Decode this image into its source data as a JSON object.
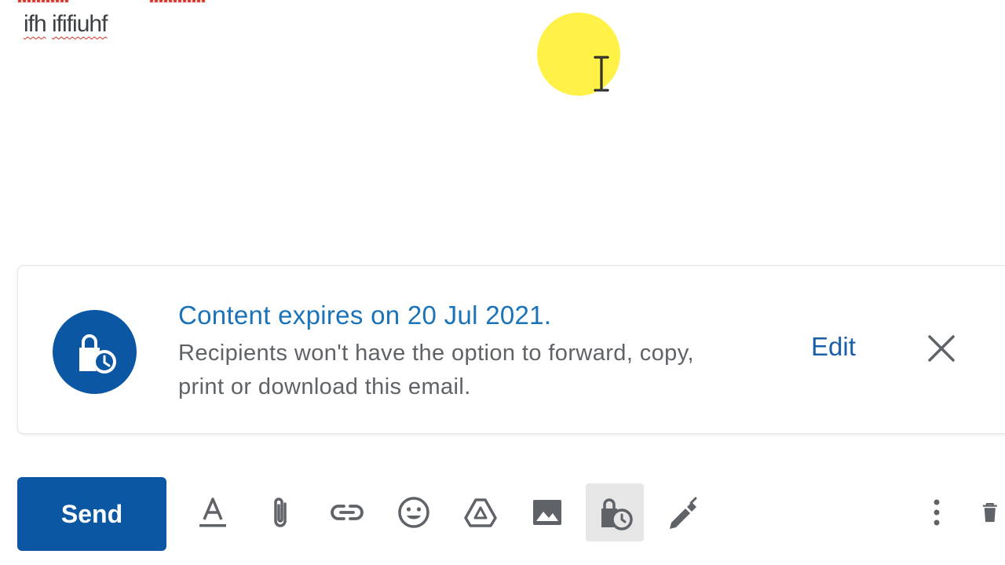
{
  "compose": {
    "body_text_1": "ifh",
    "body_text_2": "ififiuhf"
  },
  "banner": {
    "title": "Content expires on 20 Jul 2021.",
    "description": "Recipients won't have the option to forward, copy, print or download this email.",
    "edit_label": "Edit",
    "icon": "confidential-lock-clock-icon",
    "accent_color": "#0b57a4",
    "title_color": "#1a73b8"
  },
  "toolbar": {
    "send_label": "Send",
    "send_color": "#0b57a4",
    "tools": [
      {
        "name": "formatting-options",
        "icon": "text-format-icon"
      },
      {
        "name": "attach-files",
        "icon": "paperclip-icon"
      },
      {
        "name": "insert-link",
        "icon": "link-icon"
      },
      {
        "name": "insert-emoji",
        "icon": "emoji-icon"
      },
      {
        "name": "insert-from-drive",
        "icon": "drive-icon"
      },
      {
        "name": "insert-photo",
        "icon": "image-icon"
      },
      {
        "name": "confidential-mode",
        "icon": "lock-clock-icon",
        "active": true
      },
      {
        "name": "insert-signature",
        "icon": "pen-icon"
      },
      {
        "name": "more-options",
        "icon": "more-vert-icon"
      },
      {
        "name": "discard-draft",
        "icon": "trash-icon"
      }
    ]
  }
}
